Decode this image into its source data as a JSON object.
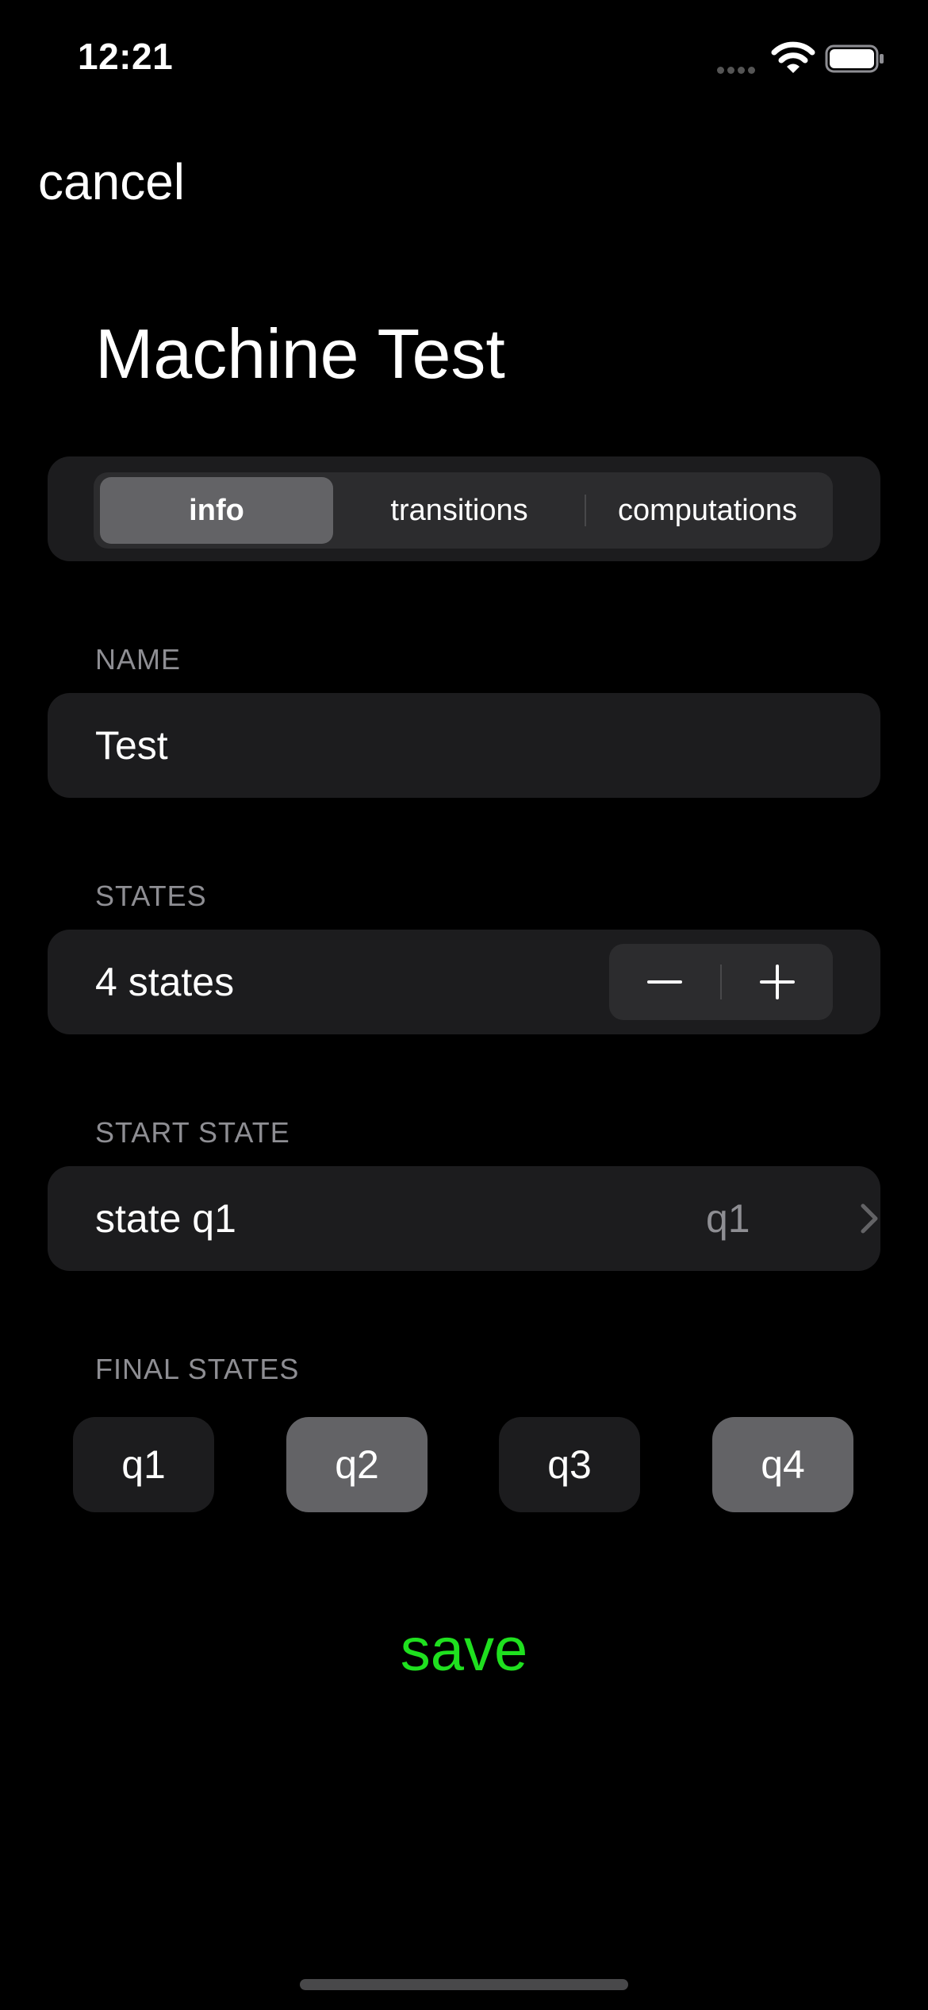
{
  "status_bar": {
    "time": "12:21"
  },
  "nav": {
    "cancel_label": "cancel"
  },
  "title": "Machine Test",
  "tabs": [
    {
      "label": "info",
      "selected": true
    },
    {
      "label": "transitions",
      "selected": false
    },
    {
      "label": "computations",
      "selected": false
    }
  ],
  "name_section": {
    "label": "NAME",
    "value": "Test"
  },
  "states_section": {
    "label": "STATES",
    "value": "4 states",
    "count": 4
  },
  "start_state_section": {
    "label": "START STATE",
    "title": "state q1",
    "value": "q1"
  },
  "final_states_section": {
    "label": "FINAL STATES",
    "chips": [
      {
        "label": "q1",
        "selected": false
      },
      {
        "label": "q2",
        "selected": true
      },
      {
        "label": "q3",
        "selected": false
      },
      {
        "label": "q4",
        "selected": true
      }
    ]
  },
  "save_label": "save",
  "colors": {
    "background": "#000000",
    "card": "#1c1c1e",
    "selected": "#636366",
    "save_accent": "#1fe01f",
    "secondary_text": "#8e8e93"
  }
}
